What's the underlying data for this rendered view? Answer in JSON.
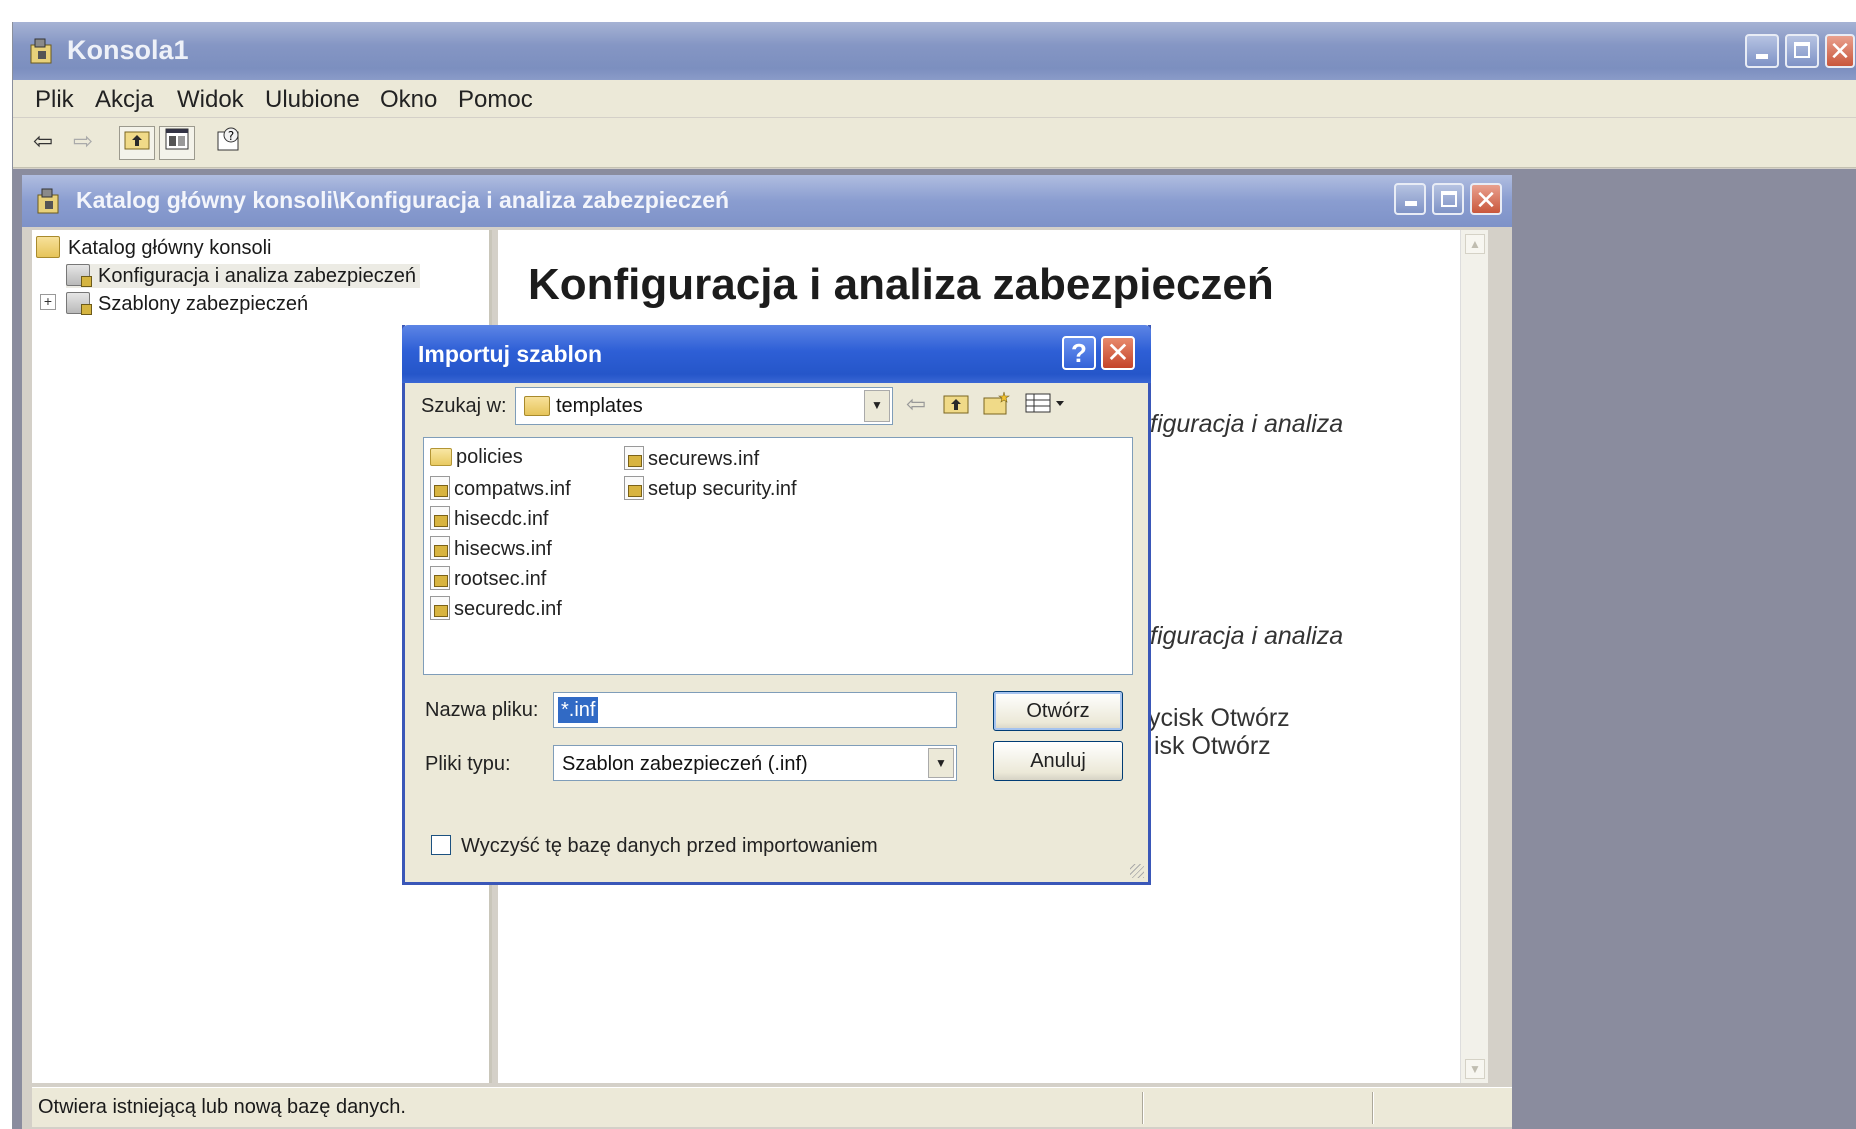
{
  "main_window": {
    "title": "Konsola1",
    "menu": [
      "Plik",
      "Akcja",
      "Widok",
      "Ulubione",
      "Okno",
      "Pomoc"
    ],
    "toolbar_icons": [
      "back-arrow-icon",
      "forward-arrow-icon",
      "up-folder-icon",
      "show-tree-icon",
      "help-icon"
    ]
  },
  "child_window": {
    "title": "Katalog główny konsoli\\Konfiguracja i analiza zabezpieczeń",
    "tree": [
      {
        "label": "Katalog główny konsoli",
        "icon": "folder-icon"
      },
      {
        "label": "Konfiguracja i analiza zabezpieczeń",
        "icon": "snapin-icon",
        "selected": true
      },
      {
        "label": "Szablony zabezpieczeń",
        "icon": "snapin-icon",
        "expandable": true
      }
    ],
    "content": {
      "heading": "Konfiguracja i analiza zabezpieczeń",
      "fragments": [
        "figuracja i analiza",
        "figuracja i analiza",
        "ycisk Otwórz",
        "isk Otwórz"
      ]
    },
    "status": "Otwiera istniejącą lub nową bazę danych."
  },
  "dialog": {
    "title": "Importuj szablon",
    "help_glyph": "?",
    "close_glyph": "✕",
    "look_in_label": "Szukaj w:",
    "look_in_value": "templates",
    "files_col1": [
      {
        "name": "policies",
        "type": "folder"
      },
      {
        "name": "compatws.inf",
        "type": "file"
      },
      {
        "name": "hisecdc.inf",
        "type": "file"
      },
      {
        "name": "hisecws.inf",
        "type": "file"
      },
      {
        "name": "rootsec.inf",
        "type": "file"
      },
      {
        "name": "securedc.inf",
        "type": "file"
      }
    ],
    "files_col2": [
      {
        "name": "securews.inf",
        "type": "file"
      },
      {
        "name": "setup security.inf",
        "type": "file"
      }
    ],
    "filename_label": "Nazwa pliku:",
    "filename_value": "*.inf",
    "filetype_label": "Pliki typu:",
    "filetype_value": "Szablon zabezpieczeń (.inf)",
    "open_button": "Otwórz",
    "cancel_button": "Anuluj",
    "checkbox_label": "Wyczyść tę bazę danych przed importowaniem"
  }
}
